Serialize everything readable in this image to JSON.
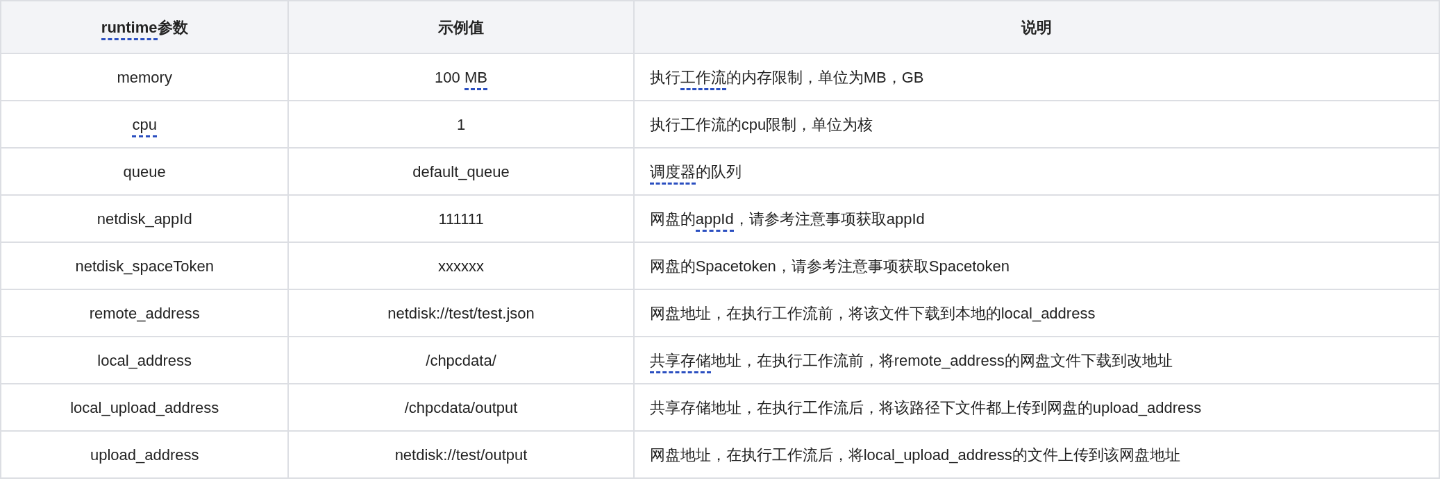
{
  "table": {
    "columns": [
      {
        "segments": [
          {
            "text": "runtime",
            "annotated": true
          },
          {
            "text": "参数",
            "annotated": false
          }
        ]
      },
      {
        "segments": [
          {
            "text": "示例值",
            "annotated": false
          }
        ]
      },
      {
        "segments": [
          {
            "text": "说明",
            "annotated": false
          }
        ]
      }
    ],
    "rows": [
      {
        "cells": [
          {
            "segments": [
              {
                "text": "memory",
                "annotated": false
              }
            ]
          },
          {
            "segments": [
              {
                "text": "100 ",
                "annotated": false
              },
              {
                "text": "MB",
                "annotated": true
              }
            ]
          },
          {
            "segments": [
              {
                "text": "执行",
                "annotated": false
              },
              {
                "text": "工作流",
                "annotated": true
              },
              {
                "text": "的内存限制，单位为MB，GB",
                "annotated": false
              }
            ]
          }
        ]
      },
      {
        "cells": [
          {
            "segments": [
              {
                "text": "cpu",
                "annotated": true
              }
            ]
          },
          {
            "segments": [
              {
                "text": "1",
                "annotated": false
              }
            ]
          },
          {
            "segments": [
              {
                "text": "执行工作流的cpu限制，单位为核",
                "annotated": false
              }
            ]
          }
        ]
      },
      {
        "cells": [
          {
            "segments": [
              {
                "text": "queue",
                "annotated": false
              }
            ]
          },
          {
            "segments": [
              {
                "text": "default_queue",
                "annotated": false
              }
            ]
          },
          {
            "segments": [
              {
                "text": "调度器",
                "annotated": true
              },
              {
                "text": "的队列",
                "annotated": false
              }
            ]
          }
        ]
      },
      {
        "cells": [
          {
            "segments": [
              {
                "text": "netdisk_appId",
                "annotated": false
              }
            ]
          },
          {
            "segments": [
              {
                "text": "111111",
                "annotated": false
              }
            ]
          },
          {
            "segments": [
              {
                "text": "网盘的",
                "annotated": false
              },
              {
                "text": "appId",
                "annotated": true
              },
              {
                "text": "，请参考注意事项获取appId",
                "annotated": false
              }
            ]
          }
        ]
      },
      {
        "cells": [
          {
            "segments": [
              {
                "text": "netdisk_spaceToken",
                "annotated": false
              }
            ]
          },
          {
            "segments": [
              {
                "text": "xxxxxx",
                "annotated": false
              }
            ]
          },
          {
            "segments": [
              {
                "text": "网盘的Spacetoken，请参考注意事项获取Spacetoken",
                "annotated": false
              }
            ]
          }
        ]
      },
      {
        "cells": [
          {
            "segments": [
              {
                "text": "remote_address",
                "annotated": false
              }
            ]
          },
          {
            "segments": [
              {
                "text": "netdisk://test/test.json",
                "annotated": false
              }
            ]
          },
          {
            "segments": [
              {
                "text": "网盘地址，在执行工作流前，将该文件下载到本地的local_address",
                "annotated": false
              }
            ]
          }
        ]
      },
      {
        "cells": [
          {
            "segments": [
              {
                "text": "local_address",
                "annotated": false
              }
            ]
          },
          {
            "segments": [
              {
                "text": "/chpcdata/",
                "annotated": false
              }
            ]
          },
          {
            "segments": [
              {
                "text": "共享存储",
                "annotated": true
              },
              {
                "text": "地址，在执行工作流前，将remote_address的网盘文件下载到改地址",
                "annotated": false
              }
            ]
          }
        ]
      },
      {
        "cells": [
          {
            "segments": [
              {
                "text": "local_upload_address",
                "annotated": false
              }
            ]
          },
          {
            "segments": [
              {
                "text": "/chpcdata/output",
                "annotated": false
              }
            ]
          },
          {
            "segments": [
              {
                "text": "共享存储地址，在执行工作流后，将该路径下文件都上传到网盘的upload_address",
                "annotated": false
              }
            ]
          }
        ]
      },
      {
        "cells": [
          {
            "segments": [
              {
                "text": "upload_address",
                "annotated": false
              }
            ]
          },
          {
            "segments": [
              {
                "text": "netdisk://test/output",
                "annotated": false
              }
            ]
          },
          {
            "segments": [
              {
                "text": "网盘地址，在执行工作流后，将local_upload_address的文件上传到该网盘地址",
                "annotated": false
              }
            ]
          }
        ]
      }
    ]
  }
}
